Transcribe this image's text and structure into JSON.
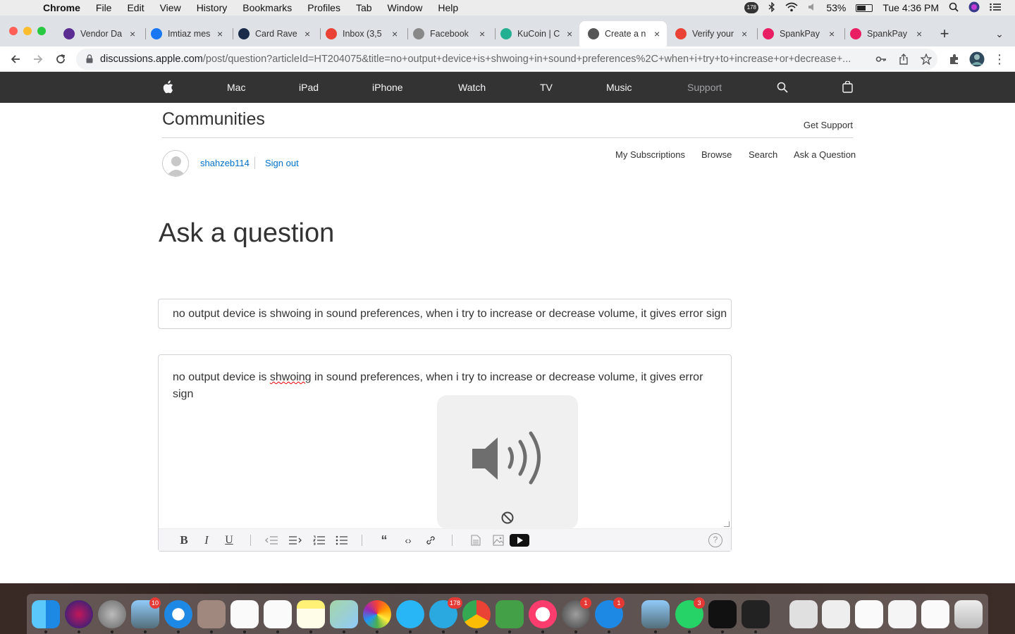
{
  "menubar": {
    "app": "Chrome",
    "items": [
      "File",
      "Edit",
      "View",
      "History",
      "Bookmarks",
      "Profiles",
      "Tab",
      "Window",
      "Help"
    ],
    "notification_count": "178",
    "battery": "53%",
    "battery_level": 0.53,
    "clock": "Tue 4:36 PM"
  },
  "tabs": [
    {
      "label": "Vendor Da",
      "icon": "vendor-icon",
      "color": "#5b2c91"
    },
    {
      "label": "Imtiaz mes",
      "icon": "facebook-icon",
      "color": "#1877f2"
    },
    {
      "label": "Card Rave",
      "icon": "vendor-v-icon",
      "color": "#1a2b4a"
    },
    {
      "label": "Inbox (3,5",
      "icon": "gmail-icon",
      "color": "#ea4335"
    },
    {
      "label": "Facebook",
      "icon": "facebook-outline-icon",
      "color": "#888888"
    },
    {
      "label": "KuCoin | C",
      "icon": "kucoin-icon",
      "color": "#23af91"
    },
    {
      "label": "Create a n",
      "icon": "apple-icon",
      "color": "#555555",
      "active": true
    },
    {
      "label": "Verify your",
      "icon": "gmail-icon",
      "color": "#ea4335"
    },
    {
      "label": "SpankPay",
      "icon": "spankpay-icon",
      "color": "#e91e63"
    },
    {
      "label": "SpankPay",
      "icon": "spankpay-icon",
      "color": "#e91e63"
    }
  ],
  "address": {
    "host": "discussions.apple.com",
    "path": "/post/question?articleId=HT204075&title=no+output+device+is+shwoing+in+sound+preferences%2C+when+i+try+to+increase+or+decrease+..."
  },
  "gnav": {
    "items": [
      "Mac",
      "iPad",
      "iPhone",
      "Watch",
      "TV",
      "Music",
      "Support"
    ]
  },
  "header": {
    "communities": "Communities",
    "get_support": "Get Support"
  },
  "user": {
    "name": "shahzeb114",
    "sign_out": "Sign out"
  },
  "subnav": [
    "My Subscriptions",
    "Browse",
    "Search",
    "Ask a Question"
  ],
  "page_title": "Ask a question",
  "question": {
    "title": "no output device is shwoing in sound preferences, when i try to increase or decrease volume, it gives error sign",
    "body_before": "no output device is ",
    "body_misspelled": "shwoing",
    "body_after": " in sound preferences, when i try to increase or decrease volume, it gives error sign"
  },
  "editor_toolbar": {
    "bold": "B",
    "italic": "I",
    "underline": "U",
    "quote": "“",
    "code": "‹›",
    "help": "?"
  },
  "dock_badges": {
    "mail": "10",
    "telegram": "178",
    "settings": "1",
    "appstore": "1",
    "whatsapp": "3"
  },
  "colors": {
    "link": "#0070c9",
    "apple_nav_bg": "#333333",
    "error_underline": "#e00000"
  }
}
